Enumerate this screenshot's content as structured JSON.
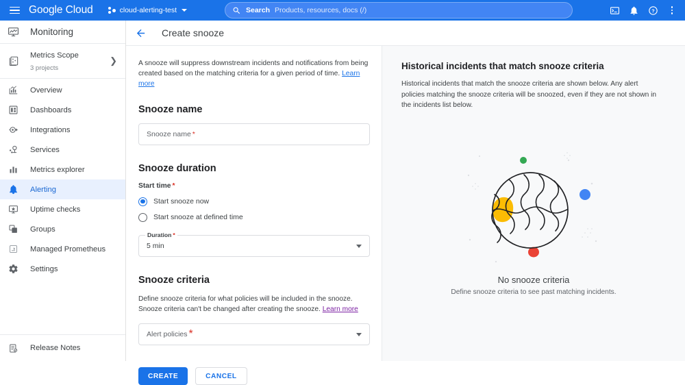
{
  "topbar": {
    "menu_icon": "hamburger-icon",
    "logo_google": "Google",
    "logo_cloud": "Cloud",
    "project_name": "cloud-alerting-test",
    "search_label": "Search",
    "search_placeholder": "Products, resources, docs (/)",
    "icons": [
      "cloud-shell-icon",
      "notifications-bell-icon",
      "help-icon",
      "more-options-icon"
    ],
    "bg_color": "#1a73e8"
  },
  "sidebar": {
    "product_title": "Monitoring",
    "scope": {
      "title": "Metrics Scope",
      "subtitle": "3 projects"
    },
    "items": [
      {
        "label": "Overview",
        "icon": "overview-chart-icon",
        "active": false
      },
      {
        "label": "Dashboards",
        "icon": "dashboards-icon",
        "active": false
      },
      {
        "label": "Integrations",
        "icon": "integrations-icon",
        "active": false
      },
      {
        "label": "Services",
        "icon": "services-icon",
        "active": false
      },
      {
        "label": "Metrics explorer",
        "icon": "bar-chart-icon",
        "active": false
      },
      {
        "label": "Alerting",
        "icon": "bell-icon",
        "active": true
      },
      {
        "label": "Uptime checks",
        "icon": "monitor-check-icon",
        "active": false
      },
      {
        "label": "Groups",
        "icon": "groups-icon",
        "active": false
      },
      {
        "label": "Managed Prometheus",
        "icon": "prometheus-icon",
        "active": false
      },
      {
        "label": "Settings",
        "icon": "gear-icon",
        "active": false
      }
    ],
    "footer_item": {
      "label": "Release Notes",
      "icon": "release-notes-icon"
    },
    "active_color": "#1967d2",
    "active_bg": "#e8f0fe"
  },
  "page": {
    "title": "Create snooze",
    "back_icon": "back-arrow-icon"
  },
  "form": {
    "intro_text": "A snooze will suppress downstream incidents and notifications from being created based on the matching criteria for a given period of time.",
    "intro_link": "Learn more",
    "name_section_title": "Snooze name",
    "name_placeholder": "Snooze name",
    "duration_section_title": "Snooze duration",
    "start_time_label": "Start time",
    "radios": [
      {
        "label": "Start snooze now",
        "selected": true
      },
      {
        "label": "Start snooze at defined time",
        "selected": false
      }
    ],
    "duration_label": "Duration",
    "duration_value": "5 min",
    "criteria_section_title": "Snooze criteria",
    "criteria_helper": "Define snooze criteria for what policies will be included in the snooze. Snooze criteria can't be changed after creating the snooze.",
    "criteria_link": "Learn more",
    "alert_policies_placeholder": "Alert policies",
    "required_marker": "*",
    "create_button": "CREATE",
    "cancel_button": "CANCEL",
    "primary_color": "#1a73e8"
  },
  "right_panel": {
    "title": "Historical incidents that match snooze criteria",
    "description": "Historical incidents that match the snooze criteria are shown below. Any alert policies matching the snooze criteria will be snoozed, even if they are not shown in the incidents list below.",
    "empty_title": "No snooze criteria",
    "empty_subtitle": "Define snooze criteria to see past matching incidents.",
    "illustration": "planet-illustration",
    "illustration_colors": {
      "green_dot": "#34a853",
      "yellow_blob": "#fbbc04",
      "blue_dot": "#4285f4",
      "red_dot": "#ea4335"
    },
    "bg_color": "#f8f9fa"
  }
}
